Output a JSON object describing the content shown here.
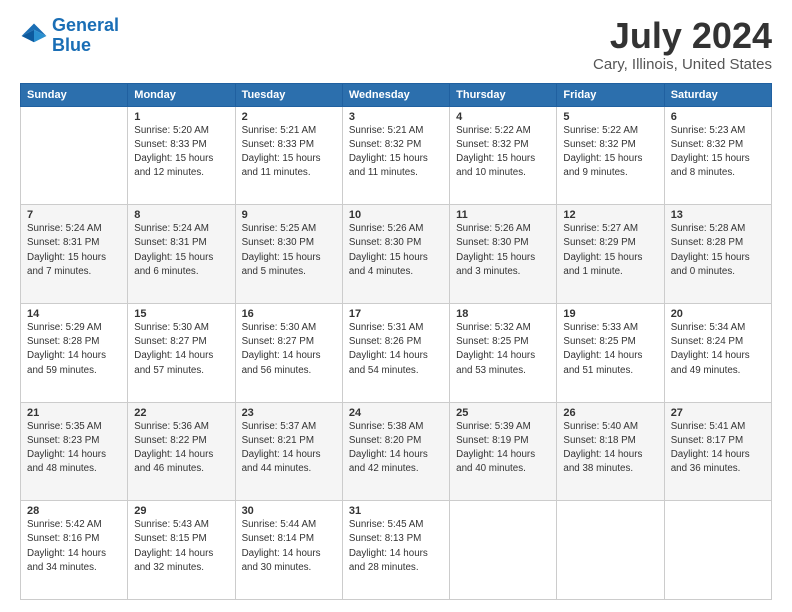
{
  "logo": {
    "line1": "General",
    "line2": "Blue"
  },
  "title": "July 2024",
  "subtitle": "Cary, Illinois, United States",
  "headers": [
    "Sunday",
    "Monday",
    "Tuesday",
    "Wednesday",
    "Thursday",
    "Friday",
    "Saturday"
  ],
  "weeks": [
    [
      {
        "day": "",
        "lines": []
      },
      {
        "day": "1",
        "lines": [
          "Sunrise: 5:20 AM",
          "Sunset: 8:33 PM",
          "Daylight: 15 hours",
          "and 12 minutes."
        ]
      },
      {
        "day": "2",
        "lines": [
          "Sunrise: 5:21 AM",
          "Sunset: 8:33 PM",
          "Daylight: 15 hours",
          "and 11 minutes."
        ]
      },
      {
        "day": "3",
        "lines": [
          "Sunrise: 5:21 AM",
          "Sunset: 8:32 PM",
          "Daylight: 15 hours",
          "and 11 minutes."
        ]
      },
      {
        "day": "4",
        "lines": [
          "Sunrise: 5:22 AM",
          "Sunset: 8:32 PM",
          "Daylight: 15 hours",
          "and 10 minutes."
        ]
      },
      {
        "day": "5",
        "lines": [
          "Sunrise: 5:22 AM",
          "Sunset: 8:32 PM",
          "Daylight: 15 hours",
          "and 9 minutes."
        ]
      },
      {
        "day": "6",
        "lines": [
          "Sunrise: 5:23 AM",
          "Sunset: 8:32 PM",
          "Daylight: 15 hours",
          "and 8 minutes."
        ]
      }
    ],
    [
      {
        "day": "7",
        "lines": [
          "Sunrise: 5:24 AM",
          "Sunset: 8:31 PM",
          "Daylight: 15 hours",
          "and 7 minutes."
        ]
      },
      {
        "day": "8",
        "lines": [
          "Sunrise: 5:24 AM",
          "Sunset: 8:31 PM",
          "Daylight: 15 hours",
          "and 6 minutes."
        ]
      },
      {
        "day": "9",
        "lines": [
          "Sunrise: 5:25 AM",
          "Sunset: 8:30 PM",
          "Daylight: 15 hours",
          "and 5 minutes."
        ]
      },
      {
        "day": "10",
        "lines": [
          "Sunrise: 5:26 AM",
          "Sunset: 8:30 PM",
          "Daylight: 15 hours",
          "and 4 minutes."
        ]
      },
      {
        "day": "11",
        "lines": [
          "Sunrise: 5:26 AM",
          "Sunset: 8:30 PM",
          "Daylight: 15 hours",
          "and 3 minutes."
        ]
      },
      {
        "day": "12",
        "lines": [
          "Sunrise: 5:27 AM",
          "Sunset: 8:29 PM",
          "Daylight: 15 hours",
          "and 1 minute."
        ]
      },
      {
        "day": "13",
        "lines": [
          "Sunrise: 5:28 AM",
          "Sunset: 8:28 PM",
          "Daylight: 15 hours",
          "and 0 minutes."
        ]
      }
    ],
    [
      {
        "day": "14",
        "lines": [
          "Sunrise: 5:29 AM",
          "Sunset: 8:28 PM",
          "Daylight: 14 hours",
          "and 59 minutes."
        ]
      },
      {
        "day": "15",
        "lines": [
          "Sunrise: 5:30 AM",
          "Sunset: 8:27 PM",
          "Daylight: 14 hours",
          "and 57 minutes."
        ]
      },
      {
        "day": "16",
        "lines": [
          "Sunrise: 5:30 AM",
          "Sunset: 8:27 PM",
          "Daylight: 14 hours",
          "and 56 minutes."
        ]
      },
      {
        "day": "17",
        "lines": [
          "Sunrise: 5:31 AM",
          "Sunset: 8:26 PM",
          "Daylight: 14 hours",
          "and 54 minutes."
        ]
      },
      {
        "day": "18",
        "lines": [
          "Sunrise: 5:32 AM",
          "Sunset: 8:25 PM",
          "Daylight: 14 hours",
          "and 53 minutes."
        ]
      },
      {
        "day": "19",
        "lines": [
          "Sunrise: 5:33 AM",
          "Sunset: 8:25 PM",
          "Daylight: 14 hours",
          "and 51 minutes."
        ]
      },
      {
        "day": "20",
        "lines": [
          "Sunrise: 5:34 AM",
          "Sunset: 8:24 PM",
          "Daylight: 14 hours",
          "and 49 minutes."
        ]
      }
    ],
    [
      {
        "day": "21",
        "lines": [
          "Sunrise: 5:35 AM",
          "Sunset: 8:23 PM",
          "Daylight: 14 hours",
          "and 48 minutes."
        ]
      },
      {
        "day": "22",
        "lines": [
          "Sunrise: 5:36 AM",
          "Sunset: 8:22 PM",
          "Daylight: 14 hours",
          "and 46 minutes."
        ]
      },
      {
        "day": "23",
        "lines": [
          "Sunrise: 5:37 AM",
          "Sunset: 8:21 PM",
          "Daylight: 14 hours",
          "and 44 minutes."
        ]
      },
      {
        "day": "24",
        "lines": [
          "Sunrise: 5:38 AM",
          "Sunset: 8:20 PM",
          "Daylight: 14 hours",
          "and 42 minutes."
        ]
      },
      {
        "day": "25",
        "lines": [
          "Sunrise: 5:39 AM",
          "Sunset: 8:19 PM",
          "Daylight: 14 hours",
          "and 40 minutes."
        ]
      },
      {
        "day": "26",
        "lines": [
          "Sunrise: 5:40 AM",
          "Sunset: 8:18 PM",
          "Daylight: 14 hours",
          "and 38 minutes."
        ]
      },
      {
        "day": "27",
        "lines": [
          "Sunrise: 5:41 AM",
          "Sunset: 8:17 PM",
          "Daylight: 14 hours",
          "and 36 minutes."
        ]
      }
    ],
    [
      {
        "day": "28",
        "lines": [
          "Sunrise: 5:42 AM",
          "Sunset: 8:16 PM",
          "Daylight: 14 hours",
          "and 34 minutes."
        ]
      },
      {
        "day": "29",
        "lines": [
          "Sunrise: 5:43 AM",
          "Sunset: 8:15 PM",
          "Daylight: 14 hours",
          "and 32 minutes."
        ]
      },
      {
        "day": "30",
        "lines": [
          "Sunrise: 5:44 AM",
          "Sunset: 8:14 PM",
          "Daylight: 14 hours",
          "and 30 minutes."
        ]
      },
      {
        "day": "31",
        "lines": [
          "Sunrise: 5:45 AM",
          "Sunset: 8:13 PM",
          "Daylight: 14 hours",
          "and 28 minutes."
        ]
      },
      {
        "day": "",
        "lines": []
      },
      {
        "day": "",
        "lines": []
      },
      {
        "day": "",
        "lines": []
      }
    ]
  ]
}
